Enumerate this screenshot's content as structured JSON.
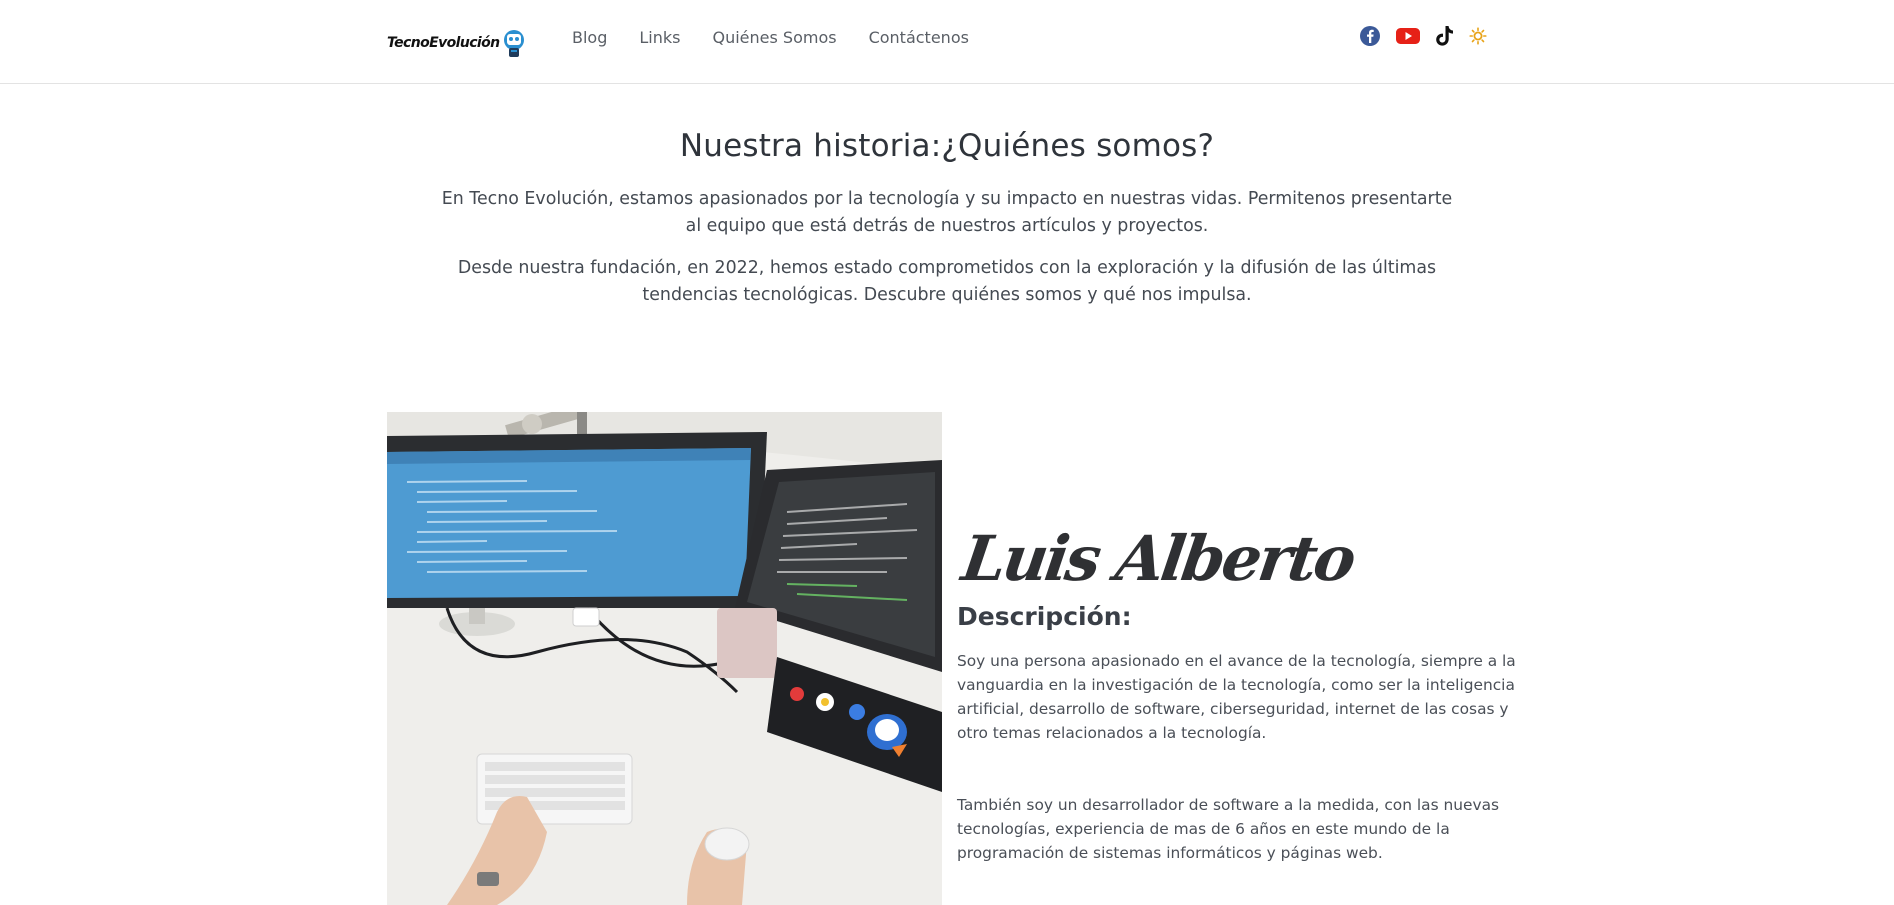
{
  "nav": {
    "brand": "TecnoEvolución",
    "links": [
      "Blog",
      "Links",
      "Quiénes Somos",
      "Contáctenos"
    ],
    "social_icons": [
      "facebook-icon",
      "youtube-icon",
      "tiktok-icon",
      "sun-icon"
    ]
  },
  "intro": {
    "title": "Nuestra historia:¿Quiénes somos?",
    "paragraph1": "En Tecno Evolución, estamos apasionados por la tecnología y su impacto en nuestras vidas. Permitenos presentarte al equipo que está detrás de nuestros artículos y proyectos.",
    "paragraph2": "Desde nuestra fundación, en 2022, hemos estado comprometidos con la exploración y la difusión de las últimas tendencias tecnológicas. Descubre quiénes somos y qué nos impulsa."
  },
  "profile": {
    "name": "Luis Alberto",
    "description_title": "Descripción:",
    "description_p1": "Soy una persona apasionado en el avance de la tecnología, siempre a la vanguardia en la investigación de la tecnología, como ser la inteligencia artificial, desarrollo de software, ciberseguridad, internet de las cosas y otro temas relacionados a la tecnología.",
    "description_p2": "También soy un desarrollador de software a la medida, con las nuevas tecnologías, experiencia de mas de 6 años en este mundo de la programación de sistemas informáticos y páginas web."
  },
  "colors": {
    "facebook": "#3b5998",
    "youtube": "#e62117",
    "tiktok": "#111111",
    "sun": "#e8a317",
    "text": "#3a3f47"
  }
}
